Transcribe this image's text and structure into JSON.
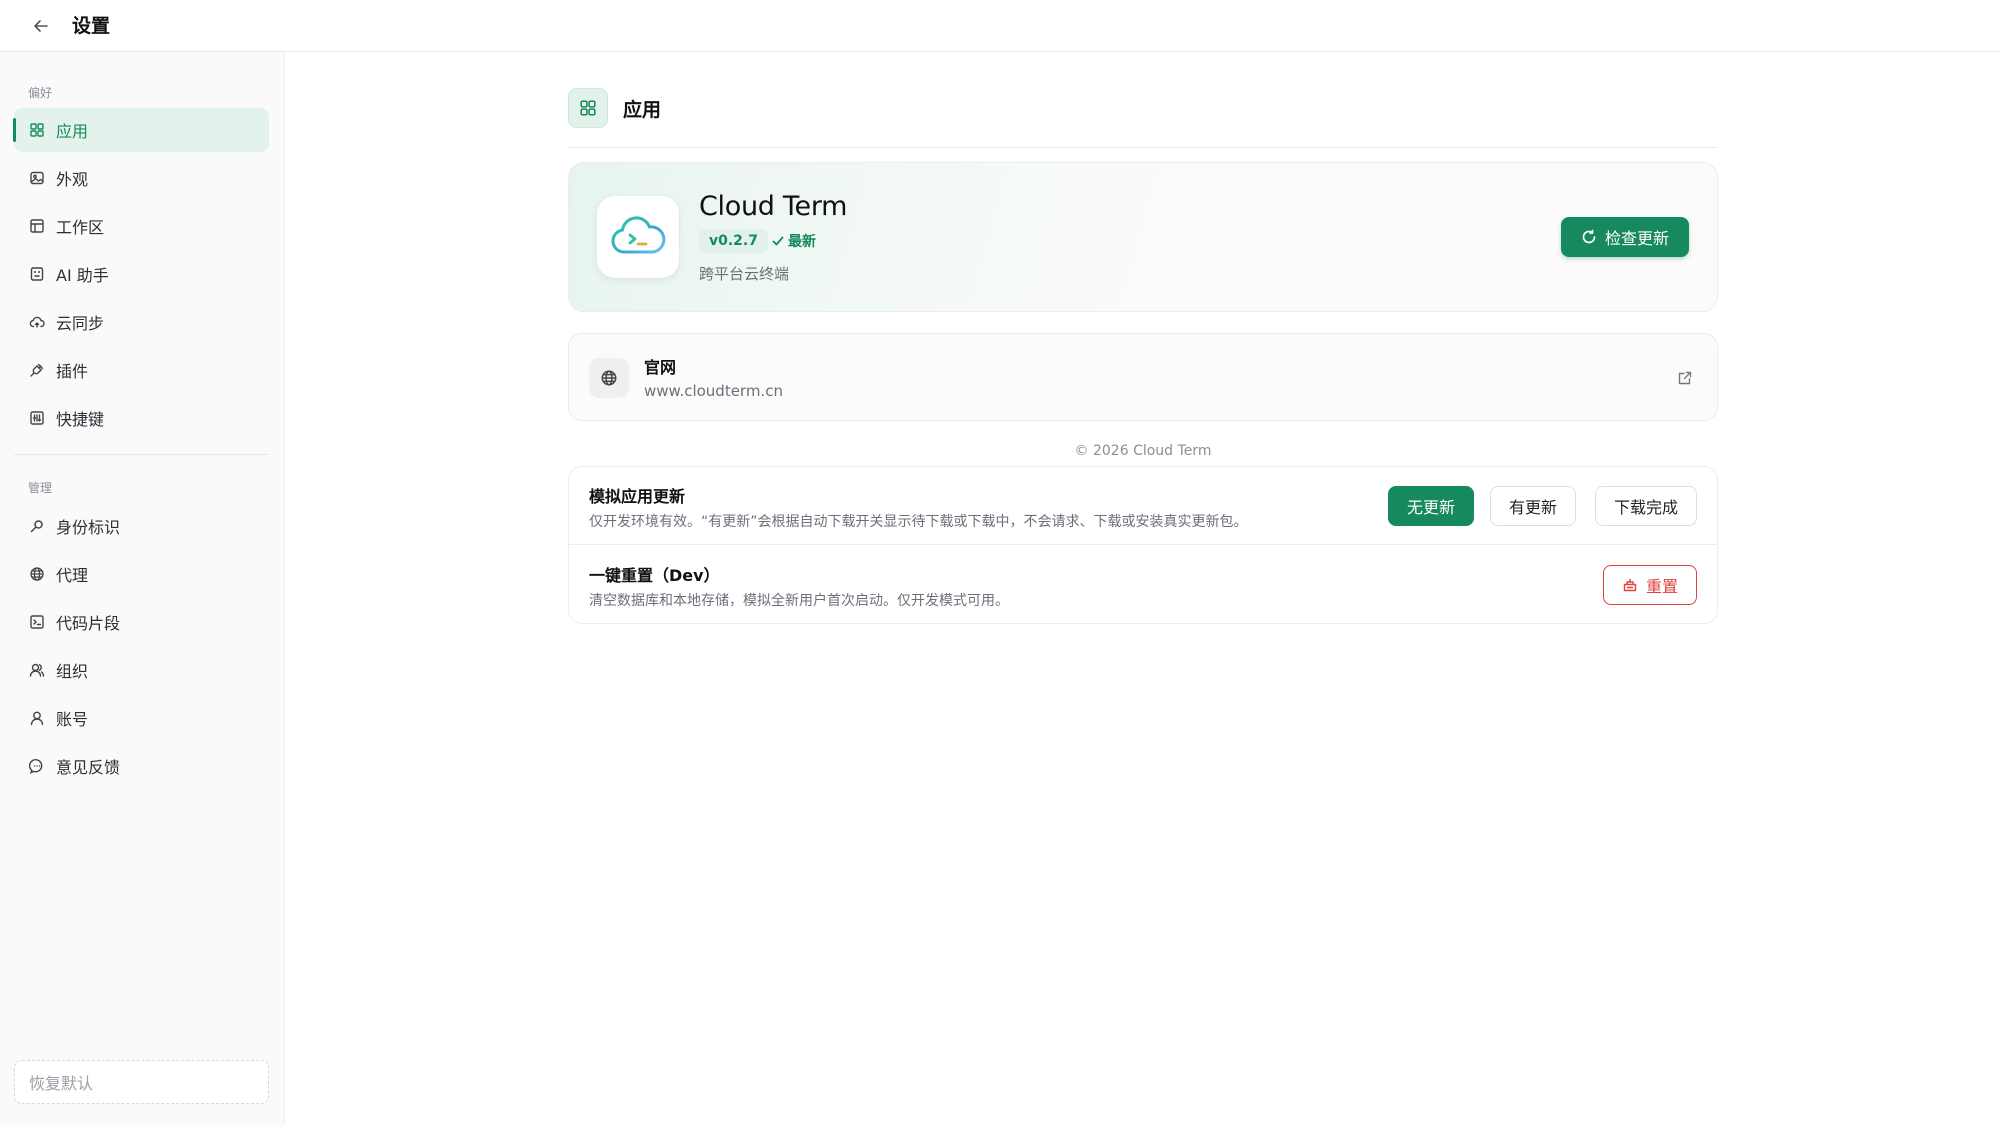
{
  "header": {
    "title": "设置",
    "back_icon": "arrow-left-icon"
  },
  "sidebar": {
    "section_preferences": "偏好",
    "section_management": "管理",
    "preferences": [
      {
        "label": "应用",
        "icon": "grid-icon",
        "active": true
      },
      {
        "label": "外观",
        "icon": "image-icon"
      },
      {
        "label": "工作区",
        "icon": "layout-icon"
      },
      {
        "label": "AI 助手",
        "icon": "robot-icon"
      },
      {
        "label": "云同步",
        "icon": "cloud-sync-icon"
      },
      {
        "label": "插件",
        "icon": "plug-icon"
      },
      {
        "label": "快捷键",
        "icon": "keyboard-icon"
      }
    ],
    "management": [
      {
        "label": "身份标识",
        "icon": "key-icon"
      },
      {
        "label": "代理",
        "icon": "globe-icon"
      },
      {
        "label": "代码片段",
        "icon": "terminal-icon"
      },
      {
        "label": "组织",
        "icon": "users-icon"
      },
      {
        "label": "账号",
        "icon": "user-icon"
      },
      {
        "label": "意见反馈",
        "icon": "chat-icon"
      }
    ],
    "restore_label": "恢复默认"
  },
  "main": {
    "title": "应用",
    "app": {
      "name": "Cloud Term",
      "version": "v0.2.7",
      "status": "最新",
      "description": "跨平台云终端",
      "check_update_label": "检查更新"
    },
    "website": {
      "title": "官网",
      "url": "www.cloudterm.cn"
    },
    "copyright": "© 2026 Cloud Term",
    "simulate": {
      "title": "模拟应用更新",
      "description": "仅开发环境有效。“有更新”会根据自动下载开关显示待下载或下载中，不会请求、下载或安装真实更新包。",
      "options": [
        "无更新",
        "有更新",
        "下载完成"
      ],
      "selected": "无更新"
    },
    "reset": {
      "title": "一键重置（Dev）",
      "description": "清空数据库和本地存储，模拟全新用户首次启动。仅开发模式可用。",
      "button_label": "重置"
    }
  },
  "colors": {
    "accent": "#16895e",
    "accent_light": "#e3f3ec",
    "danger": "#e0433f"
  }
}
